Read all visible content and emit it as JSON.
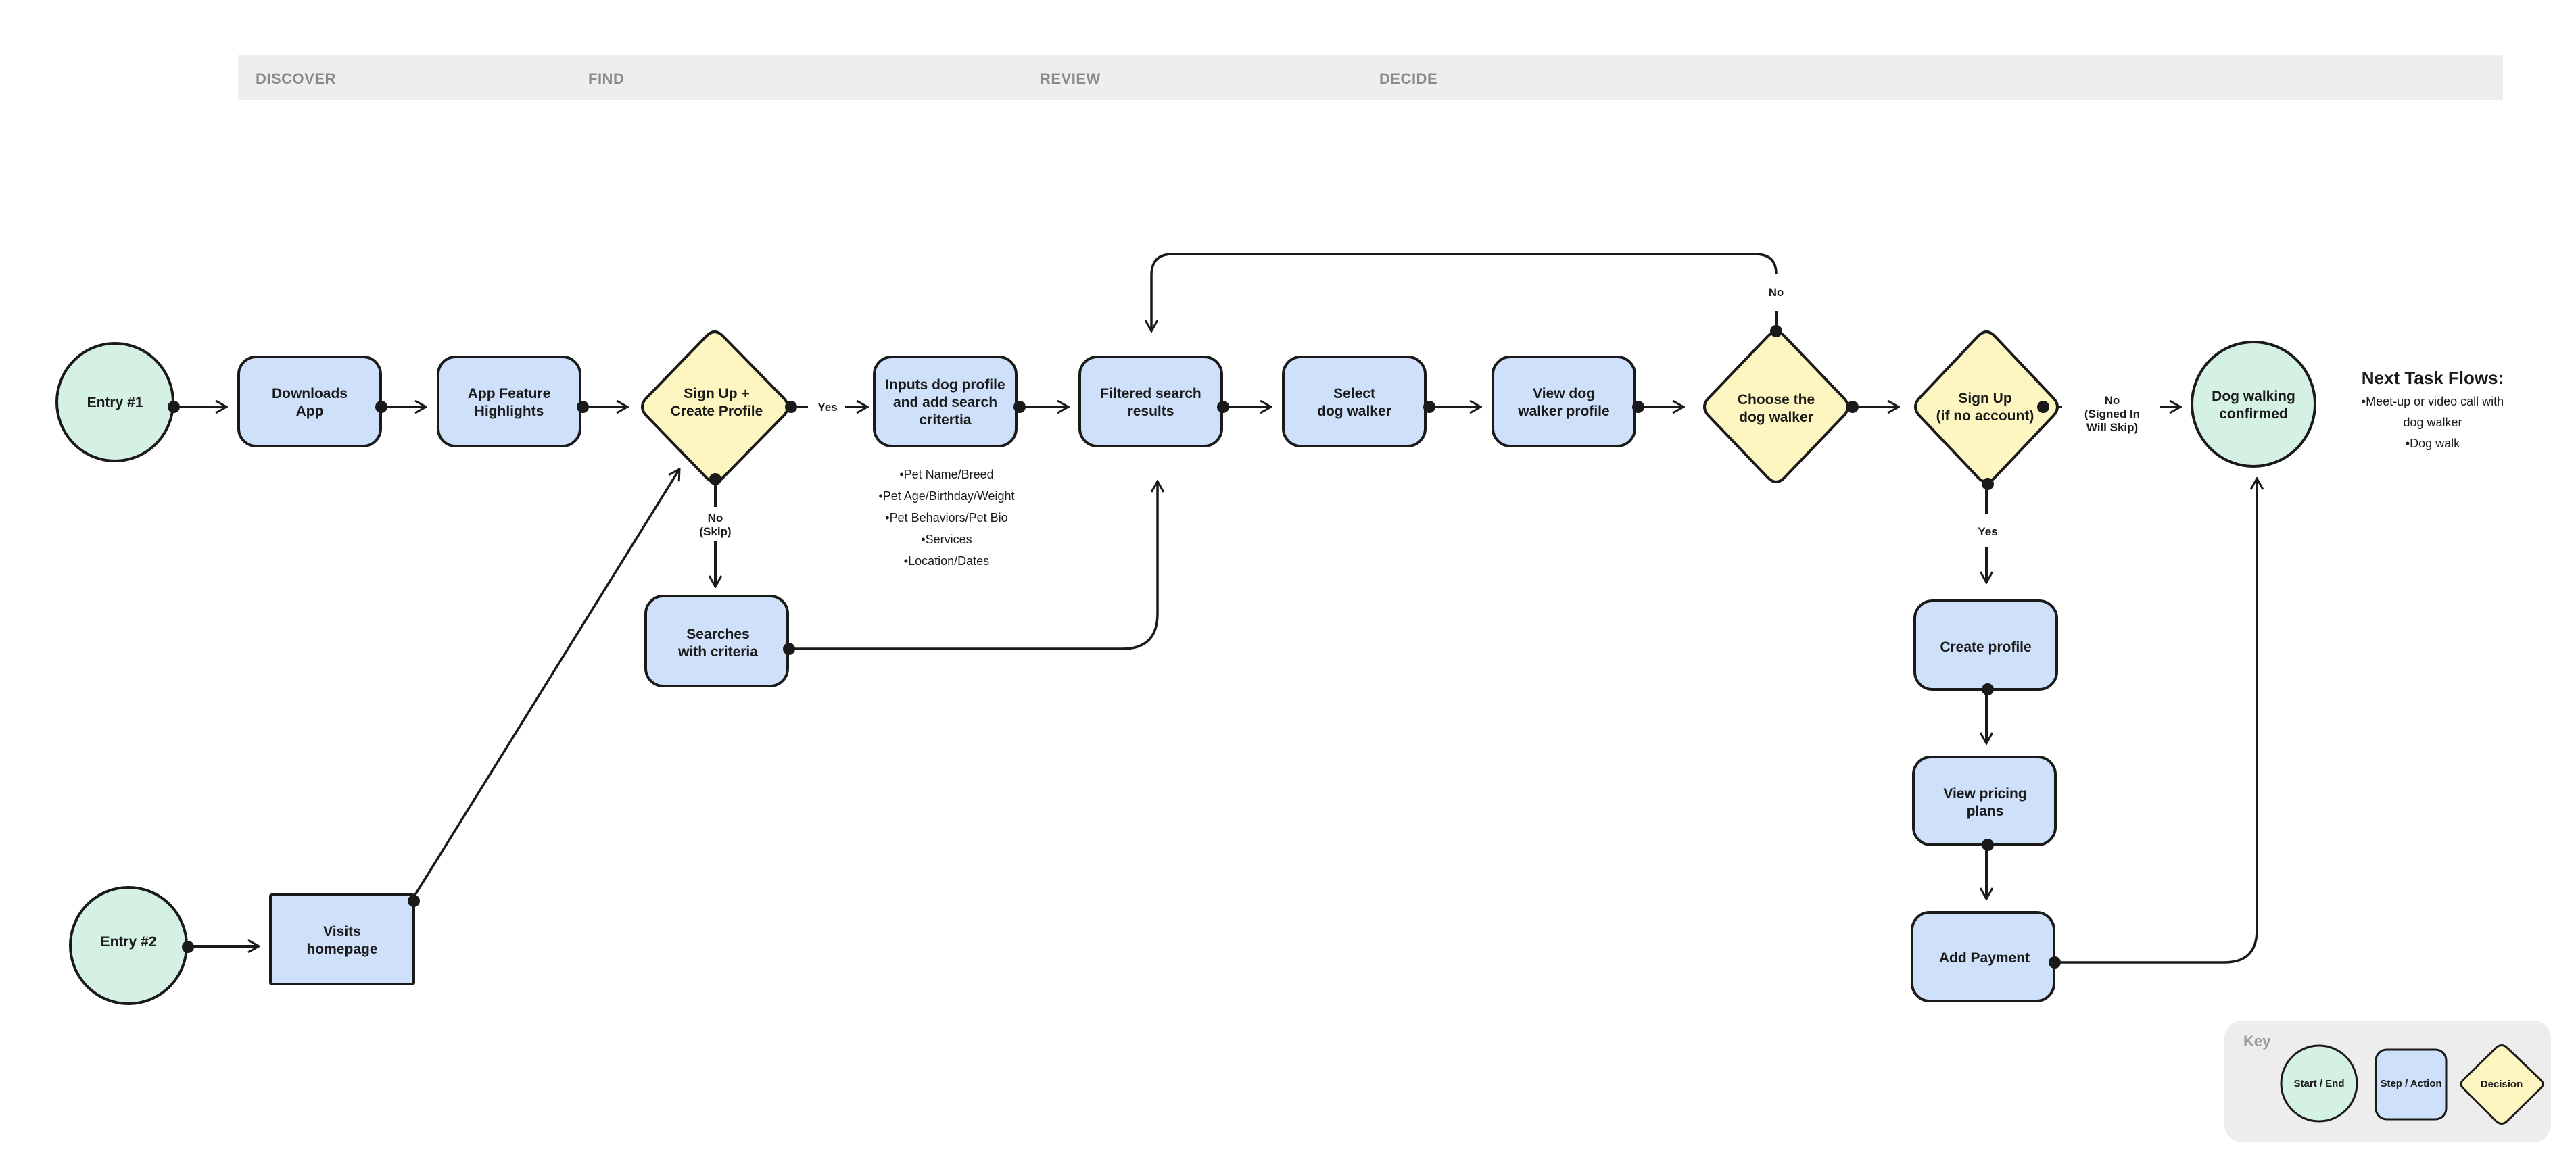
{
  "phases": [
    {
      "label": "DISCOVER"
    },
    {
      "label": "FIND"
    },
    {
      "label": "REVIEW"
    },
    {
      "label": "DECIDE"
    }
  ],
  "colors": {
    "start_end_fill": "#d5f1e4",
    "step_fill": "#cfe1fa",
    "decision_fill": "#fdf6c0",
    "stroke": "#1a1a1a",
    "phase_bar": "#eeeeee",
    "key_bg": "#ededed"
  },
  "nodes": {
    "entry1": {
      "type": "start_end",
      "lines": [
        "Entry #1"
      ]
    },
    "downloads_app": {
      "type": "step",
      "lines": [
        "Downloads",
        "App"
      ]
    },
    "feature_highlights": {
      "type": "step",
      "lines": [
        "App Feature",
        "Highlights"
      ]
    },
    "signup_create": {
      "type": "decision",
      "lines": [
        "Sign Up +",
        "Create Profile"
      ]
    },
    "inputs_profile": {
      "type": "step",
      "lines": [
        "Inputs dog profile",
        "and add search",
        "critertia"
      ]
    },
    "filtered_results": {
      "type": "step",
      "lines": [
        "Filtered search",
        "results"
      ]
    },
    "select_walker": {
      "type": "step",
      "lines": [
        "Select",
        "dog walker"
      ]
    },
    "view_walker_profile": {
      "type": "step",
      "lines": [
        "View dog",
        "walker profile"
      ]
    },
    "choose_walker": {
      "type": "decision",
      "lines": [
        "Choose the",
        "dog walker"
      ]
    },
    "signup_if_none": {
      "type": "decision",
      "lines": [
        "Sign Up",
        "(if no account)"
      ]
    },
    "confirmed": {
      "type": "start_end",
      "lines": [
        "Dog walking",
        "confirmed"
      ]
    },
    "searches_criteria": {
      "type": "step",
      "lines": [
        "Searches",
        "with criteria"
      ]
    },
    "create_profile": {
      "type": "step",
      "lines": [
        "Create profile"
      ]
    },
    "view_pricing": {
      "type": "step",
      "lines": [
        "View pricing",
        "plans"
      ]
    },
    "add_payment": {
      "type": "step",
      "lines": [
        "Add Payment"
      ]
    },
    "entry2": {
      "type": "start_end",
      "lines": [
        "Entry #2"
      ]
    },
    "visits_homepage": {
      "type": "step",
      "lines": [
        "Visits",
        "homepage"
      ]
    }
  },
  "edge_labels": {
    "signup_yes": "Yes",
    "signup_no": [
      "No",
      "(Skip)"
    ],
    "choose_no": "No",
    "signup2_no": [
      "No",
      "(Signed In",
      "Will Skip)"
    ],
    "signup2_yes": "Yes"
  },
  "criteria_list": [
    "•Pet Name/Breed",
    "•Pet Age/Birthday/Weight",
    "•Pet Behaviors/Pet Bio",
    "•Services",
    "•Location/Dates"
  ],
  "next_task_flows": {
    "title": "Next Task Flows:",
    "lines": [
      "•Meet-up or video call with",
      "dog walker",
      "•Dog walk"
    ]
  },
  "key": {
    "title": "Key",
    "items": [
      {
        "type": "start_end",
        "label": "Start / End"
      },
      {
        "type": "step",
        "label": "Step / Action"
      },
      {
        "type": "decision",
        "label": "Decision"
      }
    ]
  }
}
